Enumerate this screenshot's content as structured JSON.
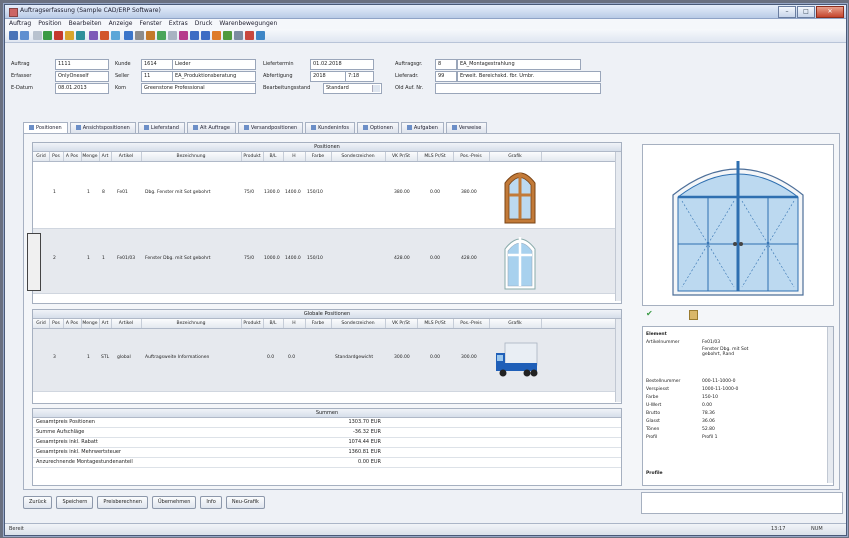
{
  "window": {
    "title": "Auftragserfassung (Sample CAD/ERP Software)"
  },
  "menubar": [
    "Auftrag",
    "Position",
    "Bearbeiten",
    "Anzeige",
    "Fenster",
    "Extras",
    "Druck",
    "Warenbewegungen"
  ],
  "form": {
    "auftrag_label": "Auftrag",
    "auftrag_nr": "1111",
    "kunde_label": "Kunde",
    "kunde_nr": "1614",
    "kunde_name": "Lieder",
    "erfasser_label": "Erfasser",
    "erfasser_value": "OnlyOneself",
    "seller_label": "Seller",
    "seller_nr": "11",
    "seller_name": "EA_Produktionsberatung",
    "edatum_label": "E-Datum",
    "edatum_value": "08.01.2013",
    "kom_label": "Kom",
    "kom_value": "Greenstone Professional",
    "liefertermin_label": "Liefertermin",
    "liefertermin_value": "01.02.2018",
    "abfertigung_label": "Abfertigung",
    "abfertigung_value": "2018",
    "abfertigung_time": "7:18",
    "bearbeitungsstand_label": "Bearbeitungsstand",
    "bearbeitungsstand_value": "Standard",
    "auftragsgruppe_label": "Auftragsgr.",
    "auftragsgruppe_nr": "8",
    "auftragsgruppe_name": "EA_Montagestrahlung",
    "lieferadr_label": "Lieferadr.",
    "lieferadr_nr": "99",
    "lieferadr_name": "Erweit. Bereichskd. fbr. Umbr.",
    "oldauftnr_label": "Old Auf. Nr."
  },
  "tabs": [
    "Positionen",
    "Ansichtspositionen",
    "Lieferstand",
    "Alt Auftrage",
    "Versandpositionen",
    "Kundeninfos",
    "Optionen",
    "Aufgaben",
    "Verweise"
  ],
  "positions": {
    "header": "Positionen",
    "columns": [
      "Grid",
      "Pos",
      "A Pos",
      "Menge",
      "Art",
      "Artikel",
      "Bezeichnung",
      "Produkt",
      "B/L",
      "H",
      "Farbe",
      "Sonderzeichen",
      "VK Pr/St",
      "MLS Pr/St",
      "Pos.-Preis",
      "Grafik"
    ],
    "rows": [
      {
        "pos": "1",
        "menge": "1",
        "art": "8",
        "artikel": "Fe01",
        "bez": "Dbg. Fenster mit Sot gebohrt",
        "produkt": "75/0",
        "bl": "1300.0",
        "h": "1400.0",
        "farbe": "150/10",
        "vk": "380.00",
        "mls": "0.00",
        "preis": "380.00"
      },
      {
        "pos": "2",
        "menge": "1",
        "art": "1",
        "artikel": "Fe01/03",
        "bez": "Fenster Dbg. mit Sot gebohrt",
        "produkt": "75/0",
        "bl": "1000.0",
        "h": "1400.0",
        "farbe": "150/10",
        "vk": "428.00",
        "mls": "0.00",
        "preis": "428.00"
      }
    ]
  },
  "global_positions": {
    "header": "Globale Positionen",
    "rows": [
      {
        "pos": "3",
        "menge": "1",
        "art": "STL",
        "artikel": "global",
        "bez": "Auftragsweite Informationen",
        "bl": "0.0",
        "h": "0.0",
        "sonder": "Standardgewicht",
        "vk": "300.00",
        "mls": "0.00",
        "preis": "300.00"
      }
    ]
  },
  "summary": {
    "header": "Summen",
    "rows": [
      {
        "label": "Gesamtpreis Positionen",
        "value": "1303.70 EUR"
      },
      {
        "label": "Summe Aufschläge",
        "value": "-36.32 EUR"
      },
      {
        "label": "Gesamtpreis inkl. Rabatt",
        "value": "1074.44 EUR"
      },
      {
        "label": "Gesamtpreis inkl. Mehrwertsteuer",
        "value": "1360.81 EUR"
      },
      {
        "label": "Anzurechnende Montagestundenanteil",
        "value": "0.00 EUR"
      }
    ]
  },
  "info": {
    "section": "Element",
    "rows": [
      {
        "label": "Artikelnummer",
        "value": "Fe01/03"
      },
      {
        "label": "",
        "value": "Fenster Dbg. mit Sot gebohrt, Rand"
      },
      {
        "label": "Bestellnummer",
        "value": "000-11-1000-0"
      },
      {
        "label": "Verspiesst",
        "value": "1000-11-1000-0"
      },
      {
        "label": "Farbe",
        "value": "150-10"
      },
      {
        "label": "U-Wert",
        "value": "0.00"
      },
      {
        "label": "Brutto",
        "value": "78.36"
      },
      {
        "label": "Glasst",
        "value": "36.06"
      },
      {
        "label": "Tönen",
        "value": "52.80"
      },
      {
        "label": "Profil",
        "value": "Profil 1"
      }
    ],
    "section2": "Profile"
  },
  "buttons": [
    "Zurück",
    "Speichern",
    "Preisberechnen",
    "Übernehmen",
    "Info",
    "Neu-Grafik"
  ],
  "status": {
    "left": "Bereit",
    "time": "13:17",
    "mode": "NUM"
  },
  "colors": {
    "accent": "#3d6cc4",
    "window_fill": "#bcd9f0",
    "window_frame": "#2e6fb0",
    "wood": "#c27a38"
  }
}
